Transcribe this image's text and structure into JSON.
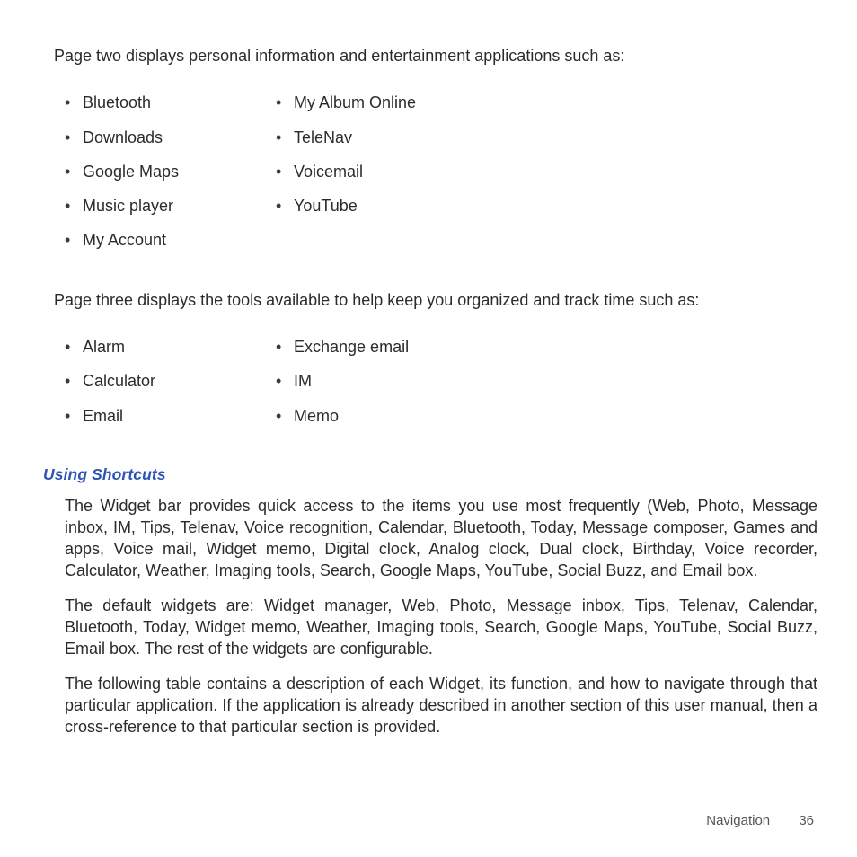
{
  "intro_p2": "Page two displays personal information and entertainment applications such as:",
  "list_p2_left": [
    "Bluetooth",
    "Downloads",
    "Google Maps",
    "Music player",
    "My Account"
  ],
  "list_p2_right": [
    "My Album Online",
    "TeleNav",
    "Voicemail",
    "YouTube"
  ],
  "intro_p3": "Page three displays the tools available to help keep you organized and track time such as:",
  "list_p3_left": [
    "Alarm",
    "Calculator",
    "Email"
  ],
  "list_p3_right": [
    "Exchange email",
    "IM",
    "Memo"
  ],
  "heading": "Using Shortcuts",
  "paragraphs": [
    "The Widget bar provides quick access to the items you use most frequently (Web, Photo, Message inbox, IM, Tips, Telenav, Voice recognition, Calendar, Bluetooth, Today, Message composer, Games and apps, Voice mail, Widget memo, Digital clock, Analog clock, Dual clock, Birthday, Voice recorder, Calculator, Weather, Imaging tools, Search, Google Maps, YouTube, Social Buzz, and Email box.",
    "The default widgets are: Widget manager, Web, Photo, Message inbox, Tips, Telenav, Calendar, Bluetooth, Today, Widget memo, Weather, Imaging tools, Search, Google Maps, YouTube, Social Buzz, Email box. The rest of the widgets are configurable.",
    "The following table contains a description of each Widget, its function, and how to navigate through that particular application. If the application is already described in another section of this user manual, then a cross-reference to that particular section is provided."
  ],
  "footer_section": "Navigation",
  "footer_page": "36"
}
